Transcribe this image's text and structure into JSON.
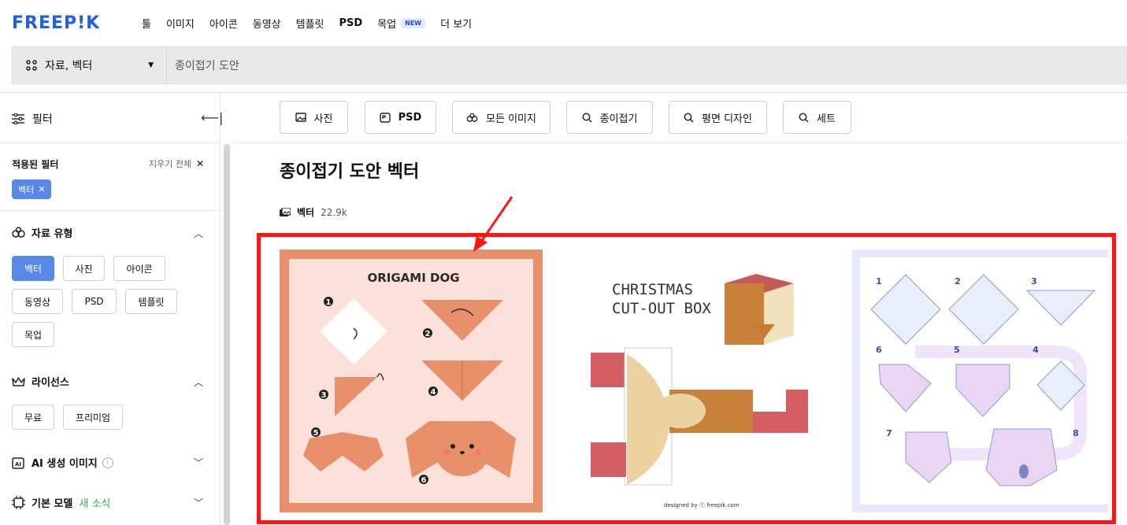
{
  "brand": {
    "logo_text": "FREEP!K",
    "color": "#1f5fe8"
  },
  "nav": {
    "items": [
      {
        "label": "툴",
        "bold": false
      },
      {
        "label": "이미지",
        "bold": false
      },
      {
        "label": "아이콘",
        "bold": false
      },
      {
        "label": "동영상",
        "bold": false
      },
      {
        "label": "템플릿",
        "bold": false
      },
      {
        "label": "PSD",
        "bold": true
      },
      {
        "label": "목업",
        "bold": false,
        "badge": "NEW"
      },
      {
        "label": "더 보기",
        "bold": false
      }
    ]
  },
  "search": {
    "type_label": "자료, 벡터",
    "query": "종이접기 도안"
  },
  "sidebar": {
    "filter_label": "필터",
    "applied_title": "적용된 필터",
    "clear_all": "지우기 전체",
    "applied_chip": "벡터",
    "asset_type": {
      "title": "자료 유형",
      "options": [
        "벡터",
        "사진",
        "아이콘",
        "동영상",
        "PSD",
        "템플릿",
        "목업"
      ]
    },
    "license": {
      "title": "라이선스",
      "options": [
        "무료",
        "프리미엄"
      ]
    },
    "ai_images": {
      "title": "AI 생성 이미지",
      "info": "i"
    },
    "base_model": {
      "title": "기본 모델",
      "new_label": "새 소식"
    }
  },
  "related": [
    {
      "label": "사진",
      "icon": "image-icon"
    },
    {
      "label": "PSD",
      "icon": "psd-icon"
    },
    {
      "label": "모든 이미지",
      "icon": "all-images-icon"
    },
    {
      "label": "종이접기",
      "icon": "search-icon"
    },
    {
      "label": "평면 디자인",
      "icon": "search-icon"
    },
    {
      "label": "세트",
      "icon": "search-icon"
    }
  ],
  "main": {
    "title": "종이접기 도안 벡터",
    "result_label": "벡터",
    "result_count": "22.9k"
  },
  "cards": {
    "dog": {
      "title": "ORIGAMI DOG",
      "steps": [
        "1",
        "2",
        "3",
        "4",
        "5",
        "6"
      ]
    },
    "box": {
      "title_line1": "CHRISTMAS",
      "title_line2": "CUT-OUT BOX",
      "credit": "designed by ⓕ freepik.com"
    },
    "koala": {
      "steps": [
        "1",
        "2",
        "3",
        "6",
        "5",
        "4",
        "7",
        "8"
      ]
    }
  },
  "colors": {
    "accent": "#5a88e8",
    "highlight": "#ff1414",
    "arrow": "#ff1414"
  }
}
